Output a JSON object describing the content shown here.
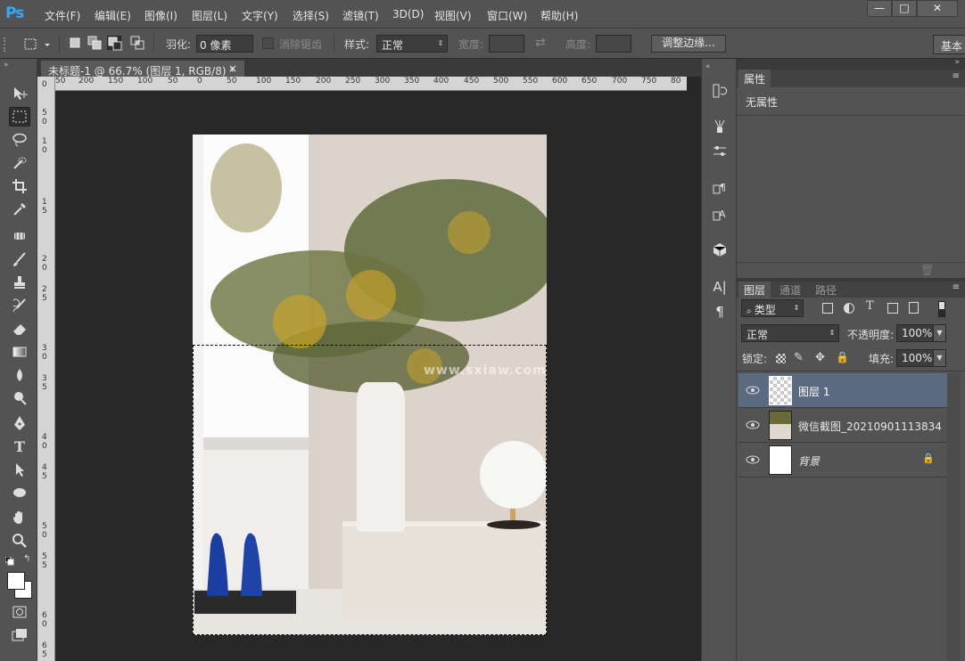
{
  "app": {
    "logo": "Ps"
  },
  "menu": [
    "文件(F)",
    "编辑(E)",
    "图像(I)",
    "图层(L)",
    "文字(Y)",
    "选择(S)",
    "滤镜(T)",
    "3D(D)",
    "视图(V)",
    "窗口(W)",
    "帮助(H)"
  ],
  "window_controls": {
    "minimize": "—",
    "maximize": "□",
    "close": "✕"
  },
  "options": {
    "feather_label": "羽化:",
    "feather_value": "0 像素",
    "antialias_label": "消除锯齿",
    "style_label": "样式:",
    "style_value": "正常",
    "width_label": "宽度:",
    "height_label": "高度:",
    "refine_edge": "调整边缘...",
    "workspace": "基本"
  },
  "document": {
    "tab_title": "未标题-1 @ 66.7% (图层 1, RGB/8) *",
    "close": "×",
    "watermark": "www.sxiaw.com",
    "h_ruler_labels": [
      "50",
      "200",
      "150",
      "100",
      "50",
      "0",
      "50",
      "100",
      "150",
      "200",
      "250",
      "300",
      "350",
      "400",
      "450",
      "500",
      "550",
      "600",
      "650",
      "700",
      "750",
      "80"
    ],
    "v_ruler_labels": [
      "0",
      "5",
      "0",
      "1",
      "0",
      "1",
      "5",
      "2",
      "0",
      "2",
      "5",
      "3",
      "0",
      "3",
      "5",
      "4",
      "0",
      "4",
      "5",
      "5",
      "0",
      "5",
      "5",
      "6",
      "0",
      "6",
      "5"
    ]
  },
  "properties_panel": {
    "tab": "属性",
    "content": "无属性"
  },
  "layers_panel": {
    "tabs": [
      "图层",
      "通道",
      "路径"
    ],
    "filter_kind": "类型",
    "blend_mode": "正常",
    "opacity_label": "不透明度:",
    "opacity_value": "100%",
    "lock_label": "锁定:",
    "fill_label": "填充:",
    "fill_value": "100%",
    "layers": [
      {
        "name": "图层 1",
        "selected": true
      },
      {
        "name": "微信截图_20210901113834",
        "selected": false
      },
      {
        "name": "背景",
        "selected": false,
        "locked": true
      }
    ]
  },
  "colors": {
    "accent": "#31a8ff",
    "selected_layer": "#5a6a80"
  }
}
